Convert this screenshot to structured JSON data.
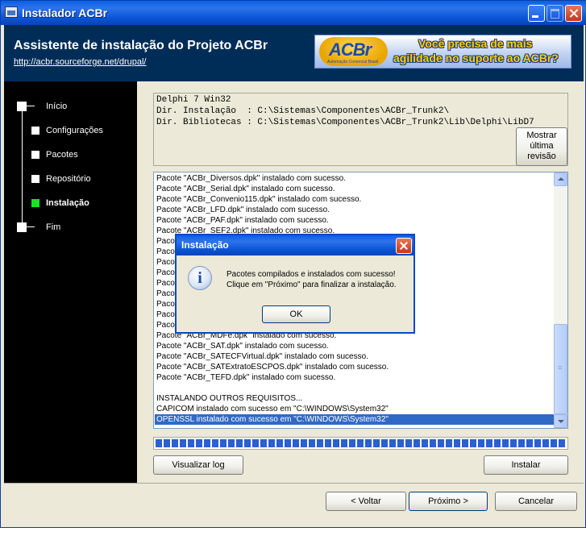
{
  "window": {
    "title": "Instalador ACBr"
  },
  "header": {
    "title": "Assistente de instalação do Projeto ACBr",
    "link": "http://acbr.sourceforge.net/drupal/",
    "banner": {
      "logo": "ACBr",
      "logo_sub": "Automação Comercial Brasil",
      "line1": "Você precisa de mais",
      "line2": "agilidade no suporte ao ACBr?"
    }
  },
  "steps": [
    {
      "label": "Início",
      "active": false
    },
    {
      "label": "Configurações",
      "active": false
    },
    {
      "label": "Pacotes",
      "active": false
    },
    {
      "label": "Repositório",
      "active": false
    },
    {
      "label": "Instalação",
      "active": true
    },
    {
      "label": "Fim",
      "active": false
    }
  ],
  "info": {
    "lines": [
      "Delphi 7 Win32",
      "Dir. Instalação  : C:\\Sistemas\\Componentes\\ACBr_Trunk2\\",
      "Dir. Bibliotecas : C:\\Sistemas\\Componentes\\ACBr_Trunk2\\Lib\\Delphi\\LibD7"
    ],
    "revision_button": [
      "Mostrar",
      "última",
      "revisão"
    ]
  },
  "log": {
    "lines": [
      "Pacote \"ACBr_Diversos.dpk\" instalado com sucesso.",
      "Pacote \"ACBr_Serial.dpk\" instalado com sucesso.",
      "Pacote \"ACBr_Convenio115.dpk\" instalado com sucesso.",
      "Pacote \"ACBr_LFD.dpk\" instalado com sucesso.",
      "Pacote \"ACBr_PAF.dpk\" instalado com sucesso.",
      "Pacote \"ACBr_SEF2.dpk\" instalado com sucesso.",
      "Pacote",
      "Pacote",
      "Pacote",
      "Pacote",
      "Pacote",
      "Pacote",
      "Pacote",
      "Pacote",
      "Pacote",
      "Pacote \"ACBr_MDFe.dpk\" instalado com sucesso.",
      "Pacote \"ACBr_SAT.dpk\" instalado com sucesso.",
      "Pacote \"ACBr_SATECFVirtual.dpk\" instalado com sucesso.",
      "Pacote \"ACBr_SATExtratoESCPOS.dpk\" instalado com sucesso.",
      "Pacote \"ACBr_TEFD.dpk\" instalado com sucesso.",
      "",
      "INSTALANDO OUTROS REQUISITOS...",
      "CAPICOM instalado com sucesso em \"C:\\WINDOWS\\System32\"",
      "OPENSSL instalado com sucesso em \"C:\\WINDOWS\\System32\""
    ],
    "selected_index": 23
  },
  "progress": {
    "value": 1.0
  },
  "buttons": {
    "visualizar_log": "Visualizar log",
    "instalar": "Instalar",
    "voltar": "< Voltar",
    "proximo": "Próximo >",
    "cancelar": "Cancelar"
  },
  "dialog": {
    "title": "Instalação",
    "message1": "Pacotes compilados e instalados com sucesso!",
    "message2": "Clique em \"Próximo\" para finalizar a instalação.",
    "ok": "OK",
    "icon": "info-icon"
  },
  "colors": {
    "header_bg": "#002d58",
    "sidebar_bg": "#000000",
    "active_step": "#21e021",
    "selection": "#316ac5"
  }
}
